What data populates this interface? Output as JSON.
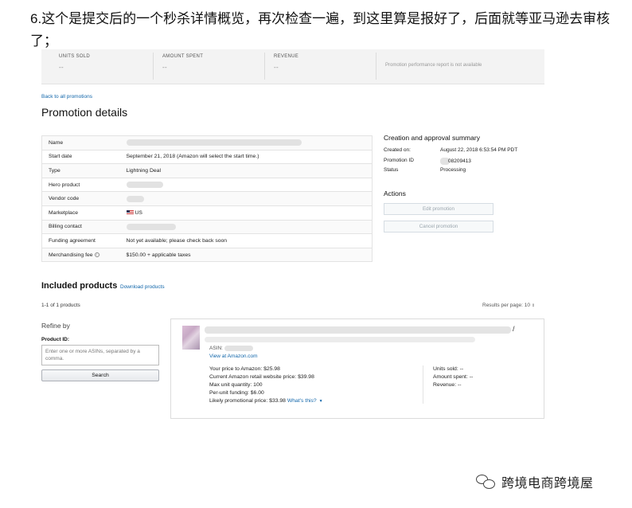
{
  "caption": {
    "number": "6.",
    "text": "这个是提交后的一个秒杀详情概览，再次检查一遍，到这里算是报好了，后面就等亚马逊去审核了；"
  },
  "stats": {
    "units_sold_label": "UNITS SOLD",
    "units_sold_value": "--",
    "amount_spent_label": "AMOUNT SPENT",
    "amount_spent_value": "--",
    "revenue_label": "REVENUE",
    "revenue_value": "--",
    "note": "Promotion performance report is not available"
  },
  "back_link": "Back to all promotions",
  "page_title": "Promotion details",
  "details": [
    {
      "key": "Name",
      "value": ""
    },
    {
      "key": "Start date",
      "value": "September 21, 2018 (Amazon will select the start time.)"
    },
    {
      "key": "Type",
      "value": "Lightning Deal"
    },
    {
      "key": "Hero product",
      "value": ""
    },
    {
      "key": "Vendor code",
      "value": ""
    },
    {
      "key": "Marketplace",
      "value": "US"
    },
    {
      "key": "Billing contact",
      "value": ""
    },
    {
      "key": "Funding agreement",
      "value": "Not yet available; please check back soon"
    },
    {
      "key": "Merchandising fee",
      "value": "$150.00 + applicable taxes"
    }
  ],
  "summary": {
    "title": "Creation and approval summary",
    "created_on_label": "Created on:",
    "created_on_value": "August 22, 2018 6:53:54 PM PDT",
    "promotion_id_label": "Promotion ID",
    "promotion_id_value": "08209413",
    "status_label": "Status",
    "status_value": "Processing"
  },
  "actions": {
    "title": "Actions",
    "edit_label": "Edit promotion",
    "cancel_label": "Cancel promotion"
  },
  "included": {
    "title": "Included products",
    "download_label": "Download products",
    "count_text": "1-1 of 1 products",
    "results_per_page_label": "Results per page:",
    "results_per_page_value": "10"
  },
  "refine": {
    "title": "Refine by",
    "product_id_label": "Product ID:",
    "product_id_placeholder": "Enter one or more ASINs, separated by a comma.",
    "search_label": "Search"
  },
  "product": {
    "asin_label": "ASIN:",
    "view_link": "View at Amazon.com",
    "your_price": "Your price to Amazon: $25.98",
    "current_price": "Current Amazon retail website price: $39.98",
    "max_qty": "Max unit quantity: 100",
    "per_unit_funding": "Per-unit funding: $6.00",
    "likely_price": "Likely promotional price: $33.98",
    "whats_this": "What's this?",
    "units_sold": "Units sold: --",
    "amount_spent": "Amount spent: --",
    "revenue": "Revenue: --"
  },
  "watermark": {
    "text": "跨境电商跨境屋"
  }
}
